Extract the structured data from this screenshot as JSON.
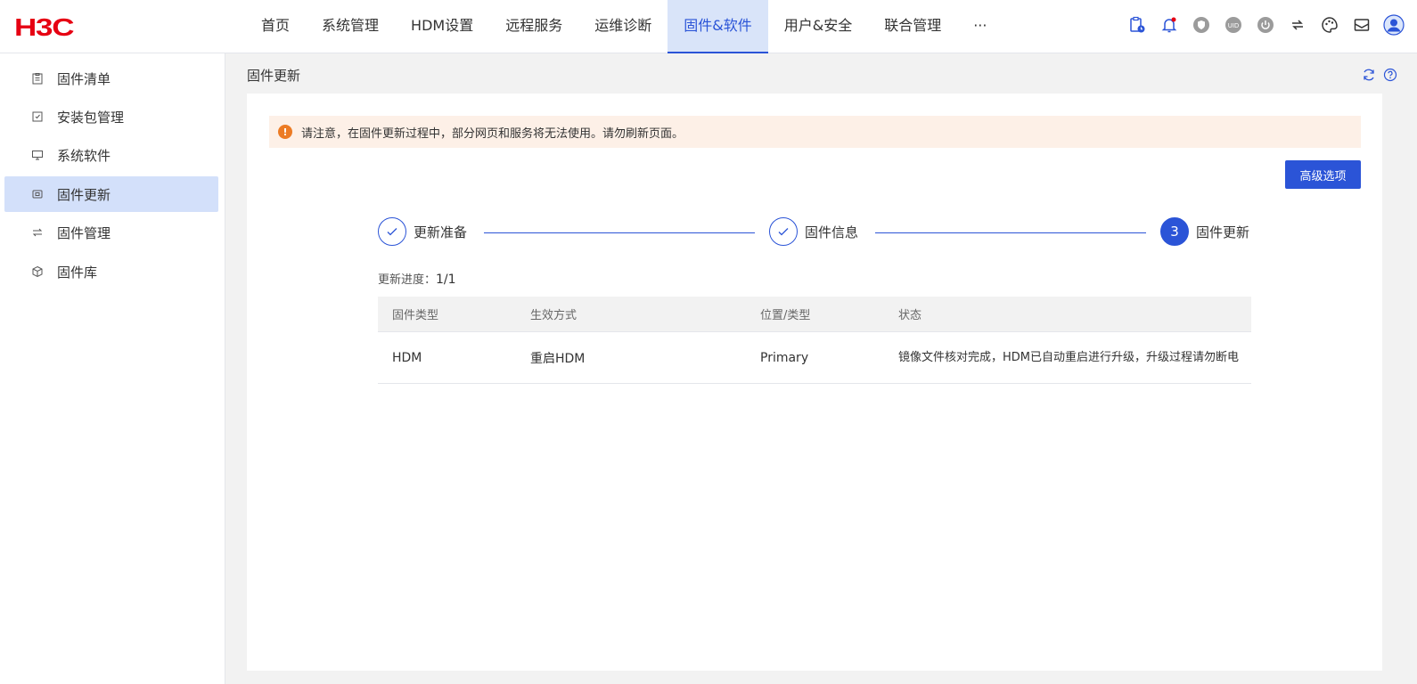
{
  "header": {
    "logo": "H3C",
    "nav": [
      "首页",
      "系统管理",
      "HDM设置",
      "远程服务",
      "运维诊断",
      "固件&软件",
      "用户&安全",
      "联合管理",
      "···"
    ],
    "active_nav": "固件&软件",
    "icons": [
      "clipboard-clock-icon",
      "bell-icon",
      "shield-icon",
      "uid-icon",
      "power-icon",
      "switch-icon",
      "palette-icon",
      "mail-icon",
      "avatar-icon"
    ],
    "uid_text": "UID"
  },
  "sidebar": {
    "items": [
      {
        "label": "固件清单",
        "icon": "clipboard-icon"
      },
      {
        "label": "安装包管理",
        "icon": "package-icon"
      },
      {
        "label": "系统软件",
        "icon": "monitor-icon"
      },
      {
        "label": "固件更新",
        "icon": "chip-icon"
      },
      {
        "label": "固件管理",
        "icon": "swap-icon"
      },
      {
        "label": "固件库",
        "icon": "cube-icon"
      }
    ],
    "active": "固件更新"
  },
  "main": {
    "title": "固件更新",
    "alert": "请注意，在固件更新过程中，部分网页和服务将无法使用。请勿刷新页面。",
    "alert_icon": "!",
    "advanced_button": "高级选项",
    "steps": [
      {
        "label": "更新准备",
        "state": "done"
      },
      {
        "label": "固件信息",
        "state": "done"
      },
      {
        "label": "固件更新",
        "state": "current",
        "number": "3"
      }
    ],
    "progress_label": "更新进度：",
    "progress_value": "1/1",
    "table": {
      "headers": [
        "固件类型",
        "生效方式",
        "位置/类型",
        "状态"
      ],
      "rows": [
        [
          "HDM",
          "重启HDM",
          "Primary",
          "镜像文件核对完成，HDM已自动重启进行升级，升级过程请勿断电"
        ]
      ]
    }
  },
  "colors": {
    "accent": "#2b54d7",
    "brand": "#e60012",
    "warning": "#ec7b24",
    "alert_bg": "#fdf0e7",
    "active_bg": "#d3e0fa"
  }
}
